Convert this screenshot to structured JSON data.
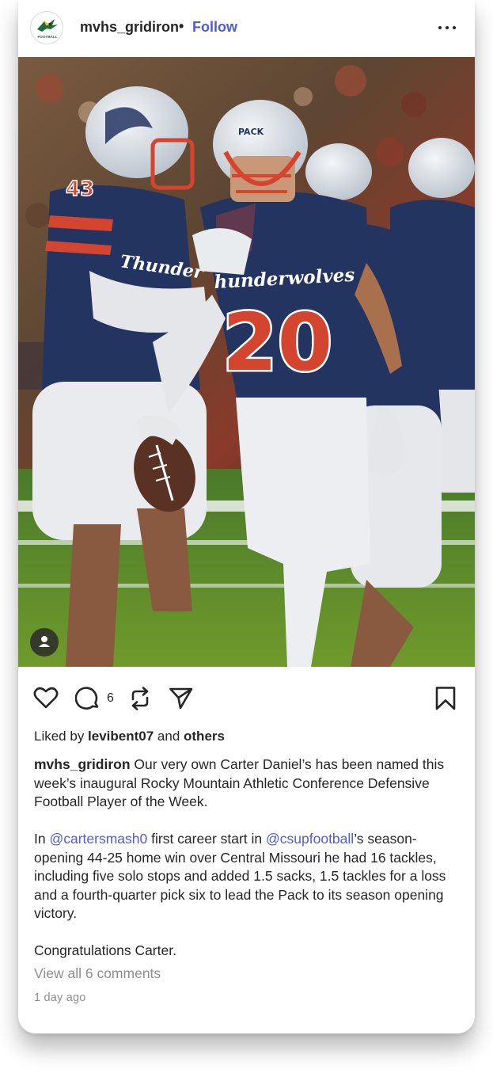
{
  "post": {
    "username": "mvhs_gridiron",
    "separator": "•",
    "follow_label": "Follow",
    "more_icon": "more-options-icon",
    "avatar_logo_text": "FOOTBALL",
    "photo": {
      "description_icon": "football-photo",
      "jersey_number_front": "20",
      "jersey_script_front": "hunderwolves",
      "jersey_number_left": "43",
      "jersey_script_left": "Thunder",
      "helmet_text": "PACK"
    },
    "actions": {
      "like_icon": "heart-icon",
      "comment_icon": "comment-icon",
      "comment_count": "6",
      "repost_icon": "repost-icon",
      "share_icon": "send-icon",
      "save_icon": "bookmark-icon"
    },
    "likes": {
      "prefix": "Liked by ",
      "user": "levibent07",
      "middle": " and ",
      "others": "others"
    },
    "caption": {
      "author": "mvhs_gridiron",
      "para1": " Our very own Carter Daniel’s has been named this week’s inaugural Rocky Mountain Athletic Conference Defensive Football Player of the Week.",
      "para2_pre": "In ",
      "mention1": "@cartersmash0",
      "para2_mid": " first career start in ",
      "mention2": "@csupfootball",
      "para2_post": "’s season-opening 44-25 home win over Central Missouri he had 16 tackles, including five solo stops and added 1.5 sacks, 1.5 tackles for a loss and a fourth-quarter pick six to lead the Pack to its season opening victory.",
      "para3": "Congratulations Carter."
    },
    "view_comments": "View all 6 comments",
    "timestamp": "1 day ago"
  }
}
